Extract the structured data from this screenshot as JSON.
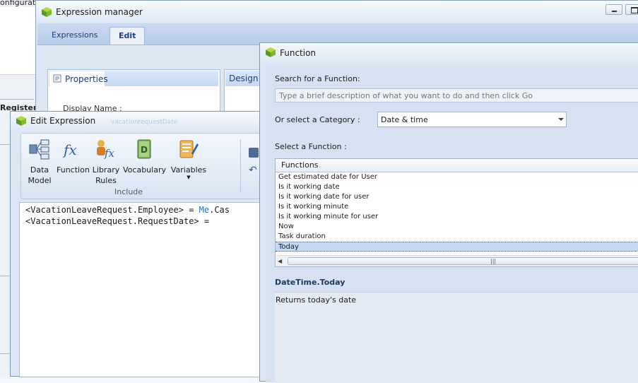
{
  "background": {
    "menu_text": "onfiguration    Help",
    "register_label": "Register"
  },
  "expression_manager": {
    "title": "Expression manager",
    "tabs": [
      {
        "label": "Expressions"
      },
      {
        "label": "Edit"
      }
    ],
    "properties_tab": "Properties",
    "display_name_label": "Display Name :",
    "design_tab": "Design"
  },
  "edit_expression": {
    "title": "Edit Expression",
    "title_ghost": "vacationrequestDate",
    "ribbon": {
      "buttons": [
        {
          "label": "Data\nModel",
          "icon": "data-model-icon"
        },
        {
          "label": "Function",
          "icon": "function-icon"
        },
        {
          "label": "Library\nRules",
          "icon": "library-rules-icon"
        },
        {
          "label": "Vocabulary",
          "icon": "vocabulary-icon"
        },
        {
          "label": "Variables",
          "icon": "variables-icon"
        }
      ],
      "group_label": "Include"
    },
    "code": {
      "line1_left": "<VacationLeaveRequest.Employee> = ",
      "line1_kw": "Me",
      "line1_rest": ".Cas",
      "line2": "<VacationLeaveRequest.RequestDate> ="
    }
  },
  "function_window": {
    "title": "Function",
    "search_label": "Search for a Function:",
    "search_placeholder": "Type a brief description of what you want to do and then click Go",
    "category_label": "Or select a Category :",
    "category_value": "Date & time",
    "select_function_label": "Select a Function :",
    "list_header": "Functions",
    "functions": [
      "Get estimated date for User",
      "Is it working date",
      "Is it working date for user",
      "Is it working minute",
      "Is it working minute for user",
      "Now",
      "Task duration",
      "Today"
    ],
    "selected_function": "Today",
    "description_title": "DateTime.Today",
    "description_text": "Returns today's date"
  },
  "colors": {
    "accent": "#1c3f75",
    "selection": "#c5d9f3",
    "keyword": "#2b6cc4"
  }
}
